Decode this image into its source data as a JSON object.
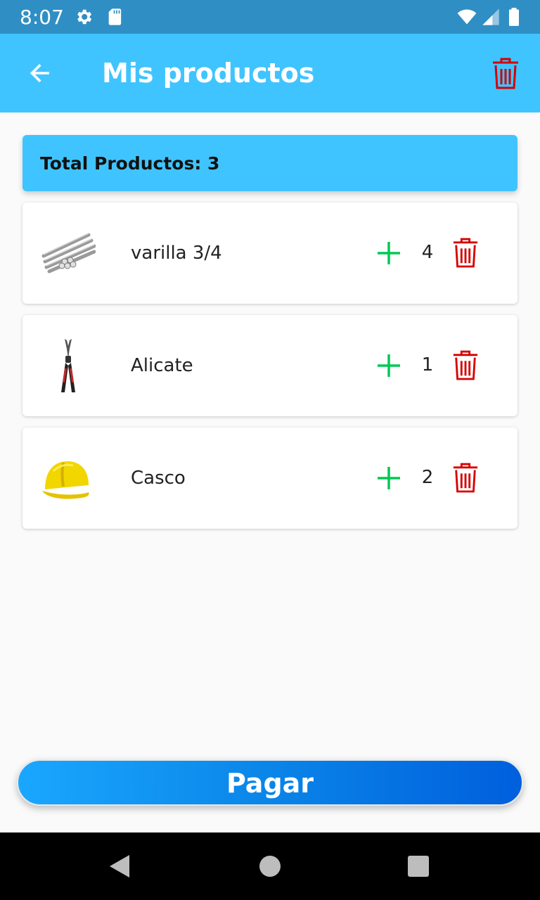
{
  "status_bar": {
    "time": "8:07",
    "icons": [
      "settings-icon",
      "sd-card-icon",
      "wifi-icon",
      "signal-icon",
      "battery-icon"
    ]
  },
  "app_bar": {
    "title": "Mis productos",
    "back_icon": "arrow-back-icon",
    "delete_icon": "trash-icon"
  },
  "summary": {
    "label": "Total Productos: 3"
  },
  "products": [
    {
      "name": "varilla 3/4",
      "quantity": "4",
      "image": "rebar-bundle-image"
    },
    {
      "name": "Alicate",
      "quantity": "1",
      "image": "pliers-image"
    },
    {
      "name": "Casco",
      "quantity": "2",
      "image": "hard-hat-image"
    }
  ],
  "checkout": {
    "button_label": "Pagar"
  },
  "colors": {
    "primary": "#40c4ff",
    "status_bar": "#2f8fc4",
    "add": "#00c853",
    "delete": "#d50000",
    "pay_start": "#1aa7ff",
    "pay_end": "#005fdd"
  },
  "nav_bar": {
    "icons": [
      "back-triangle-icon",
      "home-circle-icon",
      "recents-square-icon"
    ]
  }
}
